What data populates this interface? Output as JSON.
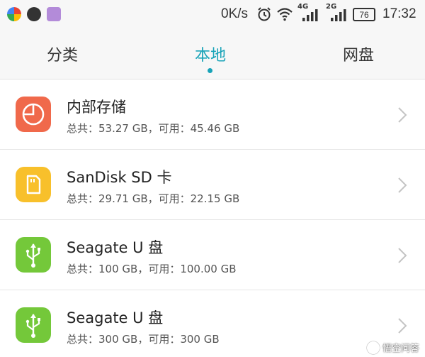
{
  "status_bar": {
    "net_speed": "0K/s",
    "net1": "4G",
    "net2": "2G",
    "battery": "76",
    "time": "17:32",
    "icons": [
      "colorful-app-icon",
      "dark-app-icon",
      "image-app-icon",
      "alarm-icon",
      "wifi-icon",
      "signal-icon",
      "signal-icon",
      "battery-icon"
    ]
  },
  "tabs": [
    {
      "label": "分类",
      "active": false
    },
    {
      "label": "本地",
      "active": true
    },
    {
      "label": "网盘",
      "active": false
    }
  ],
  "storages": [
    {
      "title": "内部存储",
      "subtitle": "总共：53.27 GB，可用：45.46 GB",
      "icon": "pie-chart-icon",
      "color": "#f0694b"
    },
    {
      "title": "SanDisk SD 卡",
      "subtitle": "总共：29.71 GB，可用：22.15 GB",
      "icon": "sd-card-icon",
      "color": "#f8c02b"
    },
    {
      "title": "Seagate U 盘",
      "subtitle": "总共：100 GB，可用：100.00 GB",
      "icon": "usb-icon",
      "color": "#74c83a"
    },
    {
      "title": "Seagate U 盘",
      "subtitle": "总共：300 GB，可用：300 GB",
      "icon": "usb-icon",
      "color": "#74c83a"
    }
  ],
  "watermark": "悟空问答",
  "colors": {
    "accent": "#18a3b8"
  }
}
